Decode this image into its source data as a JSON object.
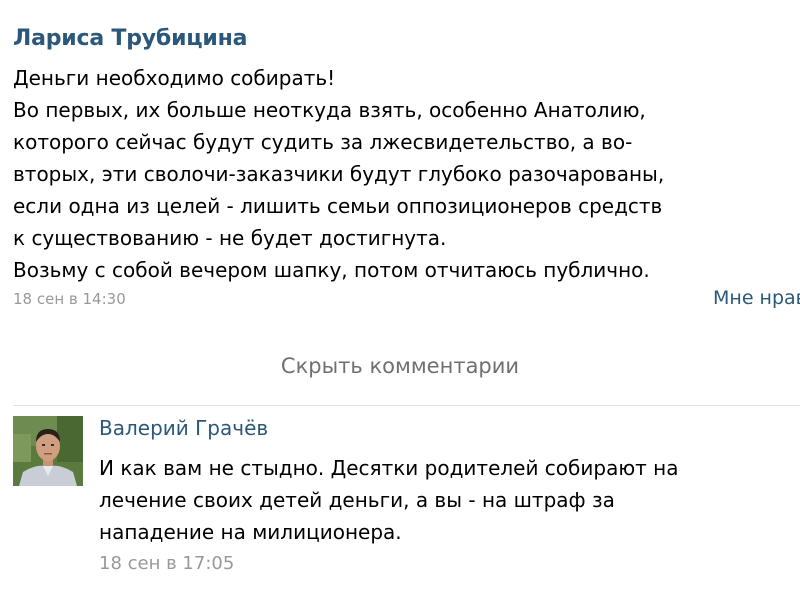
{
  "post": {
    "author": "Лариса Трубицина",
    "text_lines": [
      "Деньги необходимо собирать!",
      "Во первых, их больше неоткуда взять, особенно Анатолию,",
      "которого сейчас будут судить за лжесвидетельство, а во-",
      "вторых, эти сволочи-заказчики будут глубоко разочарованы,",
      "если одна из целей - лишить семьи оппозиционеров средств",
      "к существованию - не будет достигнута.",
      "Возьму с собой вечером шапку, потом отчитаюсь публично."
    ],
    "date": "18 сен в 14:30",
    "like_label": "Мне нравится"
  },
  "hide_comments_label": "Скрыть комментарии",
  "comment": {
    "author": "Валерий Грачёв",
    "text_lines": [
      "И как вам не стыдно. Десятки родителей собирают на",
      "лечение своих детей деньги, а вы - на штраф за",
      "нападение на милиционера."
    ],
    "date": "18 сен в 17:05"
  },
  "colors": {
    "link": "#2b587a",
    "meta": "#999999",
    "hide": "#707070",
    "divider": "#dae1e8"
  }
}
